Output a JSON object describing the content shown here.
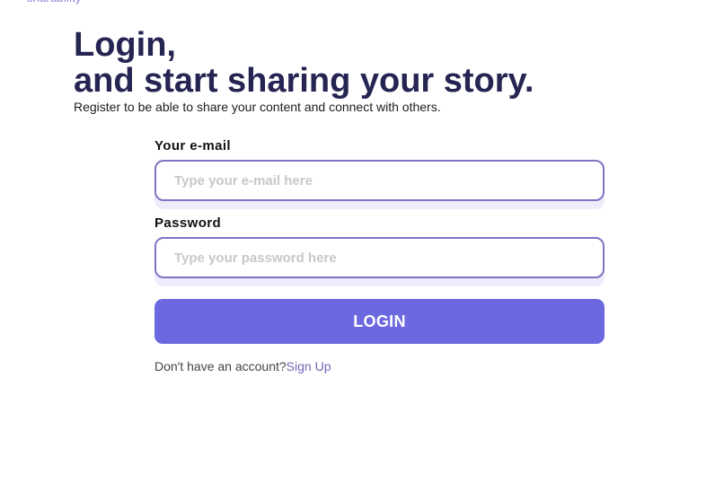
{
  "brand": {
    "logo_text": "sharability"
  },
  "header": {
    "title_line1": "Login,",
    "title_line2": "and start sharing your story.",
    "subtitle": "Register to be able to share your content and connect with others."
  },
  "form": {
    "email": {
      "label": "Your e-mail",
      "placeholder": "Type your e-mail here",
      "value": ""
    },
    "password": {
      "label": "Password",
      "placeholder": "Type your password here",
      "value": ""
    },
    "submit_label": "LOGIN",
    "signup_prompt": "Don't have an account?",
    "signup_link": "Sign Up"
  },
  "colors": {
    "heading": "#252452",
    "accent": "#6c69e0",
    "input_border": "#7e74c4",
    "link": "#6e69b8"
  }
}
